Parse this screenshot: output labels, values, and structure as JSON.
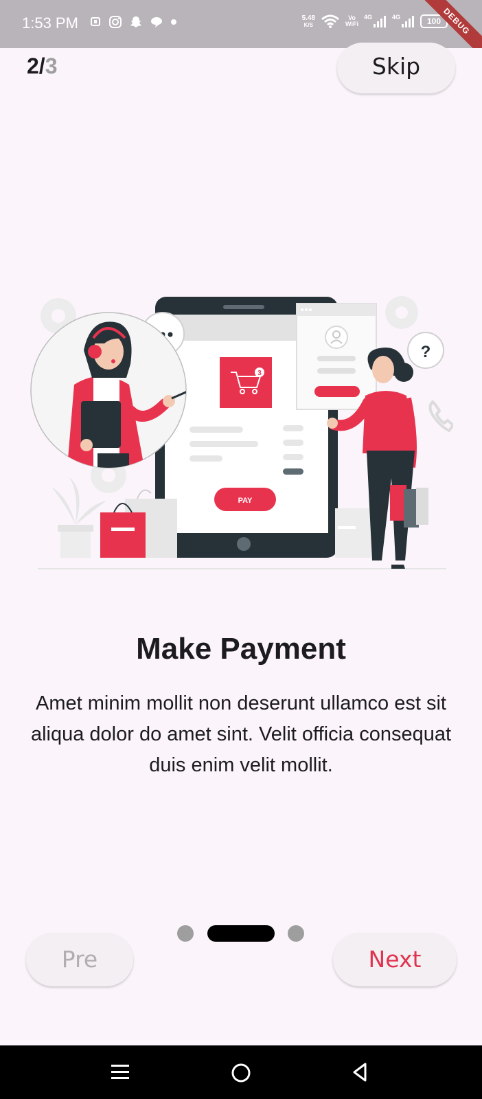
{
  "status_bar": {
    "time": "1:53 PM",
    "net_speed_value": "5.48",
    "net_speed_unit": "K/S",
    "vowifi_top": "Vo",
    "vowifi_bottom": "WiFi",
    "signal1_label": "4G",
    "signal2_label": "4G",
    "battery": "100",
    "debug_label": "DEBUG"
  },
  "header": {
    "page_current": "2/",
    "page_total": "3",
    "skip_label": "Skip"
  },
  "illustration": {
    "pay_label": "PAY",
    "cart_badge": "3",
    "question_mark": "?"
  },
  "content": {
    "title": "Make Payment",
    "description": "Amet minim mollit non deserunt ullamco est sit aliqua dolor do amet sint. Velit officia consequat duis enim velit mollit."
  },
  "pager": {
    "count": 3,
    "active_index": 1
  },
  "footer": {
    "pre_label": "Pre",
    "next_label": "Next"
  },
  "colors": {
    "accent": "#e0334f",
    "background": "#fbf5fb",
    "dot_inactive": "#9e9e9e",
    "dot_active": "#000000"
  },
  "icons": [
    "signal-icon",
    "wifi-icon",
    "instagram-icon",
    "snapchat-icon",
    "chat-icon",
    "battery-icon",
    "menu-icon",
    "home-icon",
    "back-icon"
  ]
}
